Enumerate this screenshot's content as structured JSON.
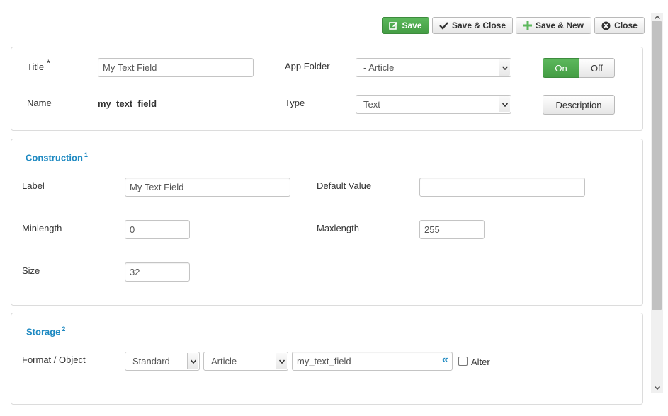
{
  "toolbar": {
    "save_label": "Save",
    "save_close_label": "Save & Close",
    "save_new_label": "Save & New",
    "close_label": "Close"
  },
  "general": {
    "title_label": "Title",
    "required_marker": "*",
    "title_value": "My Text Field",
    "name_label": "Name",
    "name_value": "my_text_field",
    "app_folder_label": "App Folder",
    "app_folder_value": "- Article",
    "type_label": "Type",
    "type_value": "Text",
    "toggle_on_label": "On",
    "toggle_off_label": "Off",
    "toggle_state": "on",
    "description_label": "Description"
  },
  "construction": {
    "title": "Construction",
    "footnote": "1",
    "label_label": "Label",
    "label_value": "My Text Field",
    "default_value_label": "Default Value",
    "default_value_value": "",
    "minlength_label": "Minlength",
    "minlength_value": "0",
    "maxlength_label": "Maxlength",
    "maxlength_value": "255",
    "size_label": "Size",
    "size_value": "32"
  },
  "storage": {
    "title": "Storage",
    "footnote": "2",
    "format_label": "Format / Object",
    "format_value": "Standard",
    "object_value": "Article",
    "field_value": "my_text_field",
    "field_action_glyph": "«",
    "alter_label": "Alter",
    "alter_checked": false
  },
  "colors": {
    "accent_green": "#5cb85c",
    "section_title_blue": "#1f8ac2"
  }
}
